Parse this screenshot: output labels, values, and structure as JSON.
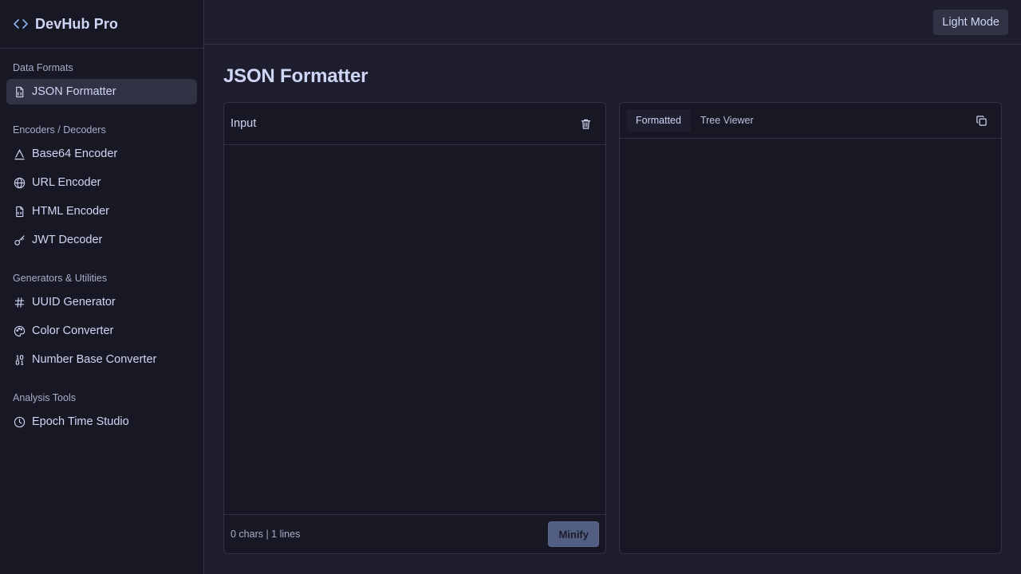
{
  "app": {
    "title": "DevHub Pro",
    "brand_icon": "code-brackets-icon"
  },
  "sidebar": {
    "sections": [
      {
        "title": "Data Formats",
        "items": [
          {
            "label": "JSON Formatter",
            "icon": "file-json-icon",
            "active": true
          }
        ]
      },
      {
        "title": "Encoders / Decoders",
        "items": [
          {
            "label": "Base64 Encoder",
            "icon": "base64-icon"
          },
          {
            "label": "URL Encoder",
            "icon": "globe-icon"
          },
          {
            "label": "HTML Encoder",
            "icon": "file-code-icon"
          },
          {
            "label": "JWT Decoder",
            "icon": "key-icon"
          }
        ]
      },
      {
        "title": "Generators & Utilities",
        "items": [
          {
            "label": "UUID Generator",
            "icon": "hash-icon"
          },
          {
            "label": "Color Converter",
            "icon": "palette-icon"
          },
          {
            "label": "Number Base Converter",
            "icon": "binary-icon"
          }
        ]
      },
      {
        "title": "Analysis Tools",
        "items": [
          {
            "label": "Epoch Time Studio",
            "icon": "clock-icon"
          }
        ]
      }
    ]
  },
  "header": {
    "theme_toggle_label": "Light Mode"
  },
  "main": {
    "title": "JSON Formatter",
    "input_panel": {
      "label": "Input",
      "value": "",
      "stats": "0 chars | 1 lines",
      "minify_label": "Minify",
      "clear_icon": "trash-icon"
    },
    "output_panel": {
      "tabs": [
        {
          "label": "Formatted",
          "active": true
        },
        {
          "label": "Tree Viewer",
          "active": false
        }
      ],
      "copy_icon": "copy-icon"
    }
  },
  "colors": {
    "background": "#1e1e2e",
    "sidebar": "#181825",
    "border": "#313244",
    "text": "#cdd6f4",
    "muted": "#a6adc8",
    "accent_button": "#5c6a92"
  }
}
